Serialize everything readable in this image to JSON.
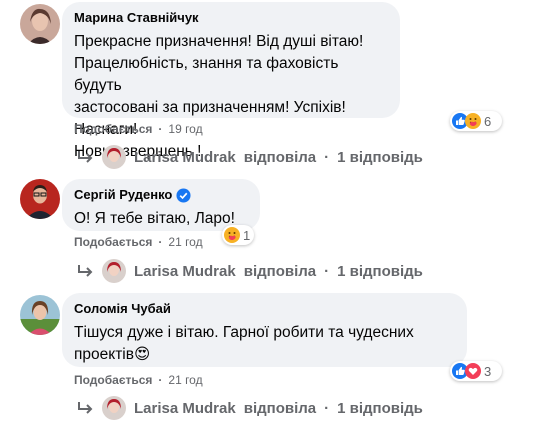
{
  "comments": [
    {
      "author": "Марина Ставнійчук",
      "text": "Прекрасне призначення! Від душі вітаю!\nПрацелюбність, знання та фаховість будуть\nзастосовані за призначенням! Успіхів! Наснаги!\nНових звершень !",
      "like_label": "Подобається",
      "sep": "·",
      "time": "19 год",
      "reaction_count": "6",
      "reactions": [
        "like-icon",
        "care-icon"
      ],
      "reply": {
        "name": "Larisa Mudrak",
        "verb": "відповіла",
        "sep": "·",
        "count": "1 відповідь"
      }
    },
    {
      "author": "Сергій Руденко",
      "verified": true,
      "text": "О! Я тебе вітаю, Ларо!",
      "like_label": "Подобається",
      "sep": "·",
      "time": "21 год",
      "reaction_count": "1",
      "reactions": [
        "care-icon"
      ],
      "reply": {
        "name": "Larisa Mudrak",
        "verb": "відповіла",
        "sep": "·",
        "count": "1 відповідь"
      }
    },
    {
      "author": "Соломія Чубай",
      "text": "Тішуся дуже і вітаю. Гарної робити та чудесних\nпроектів😍",
      "like_label": "Подобається",
      "sep": "·",
      "time": "21 год",
      "reaction_count": "3",
      "reactions": [
        "like-icon",
        "love-icon"
      ],
      "reply": {
        "name": "Larisa Mudrak",
        "verb": "відповіла",
        "sep": "·",
        "count": "1 відповідь"
      }
    }
  ],
  "colors": {
    "bubble": "#f0f2f5",
    "meta": "#65676b",
    "like": "#1877f2",
    "love": "#f33e58",
    "care": "#f7b125"
  }
}
